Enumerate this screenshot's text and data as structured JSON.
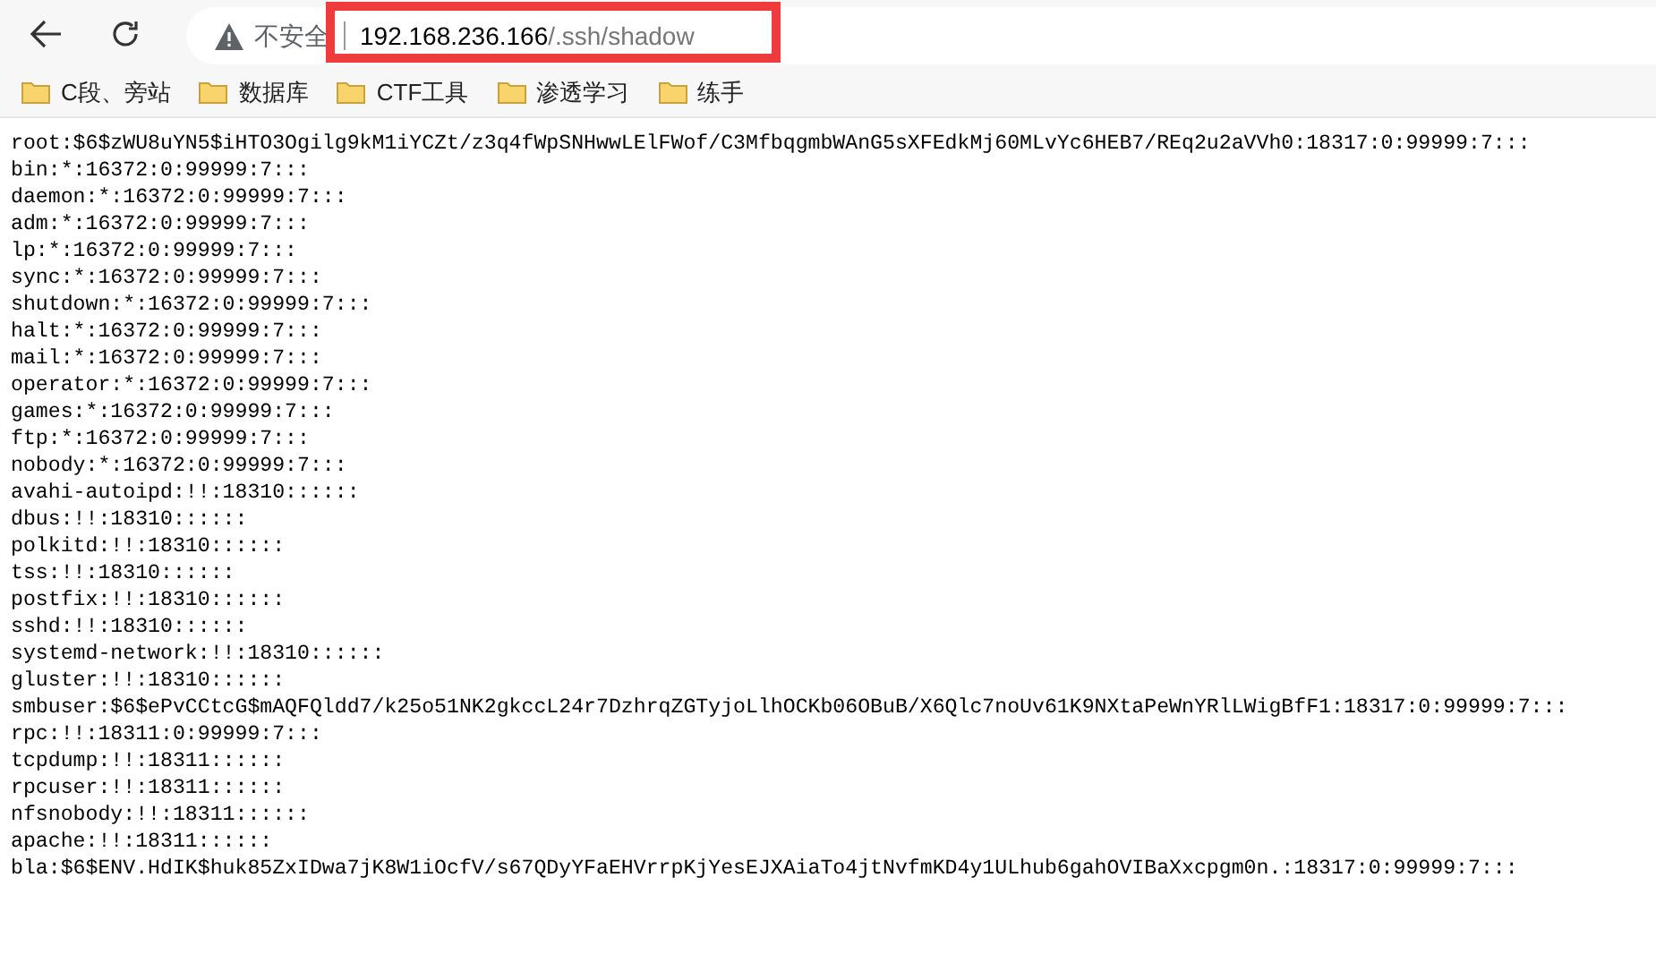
{
  "toolbar": {
    "security_label": "不安全",
    "url_host": "192.168.236.166",
    "url_path": "/.ssh/shadow"
  },
  "bookmarks": [
    "C段、旁站",
    "数据库",
    "CTF工具",
    "渗透学习",
    "练手"
  ],
  "content_lines": [
    "root:$6$zWU8uYN5$iHTO3Ogilg9kM1iYCZt/z3q4fWpSNHwwLElFWof/C3MfbqgmbWAnG5sXFEdkMj60MLvYc6HEB7/REq2u2aVVh0:18317:0:99999:7:::",
    "bin:*:16372:0:99999:7:::",
    "daemon:*:16372:0:99999:7:::",
    "adm:*:16372:0:99999:7:::",
    "lp:*:16372:0:99999:7:::",
    "sync:*:16372:0:99999:7:::",
    "shutdown:*:16372:0:99999:7:::",
    "halt:*:16372:0:99999:7:::",
    "mail:*:16372:0:99999:7:::",
    "operator:*:16372:0:99999:7:::",
    "games:*:16372:0:99999:7:::",
    "ftp:*:16372:0:99999:7:::",
    "nobody:*:16372:0:99999:7:::",
    "avahi-autoipd:!!:18310::::::",
    "dbus:!!:18310::::::",
    "polkitd:!!:18310::::::",
    "tss:!!:18310::::::",
    "postfix:!!:18310::::::",
    "sshd:!!:18310::::::",
    "systemd-network:!!:18310::::::",
    "gluster:!!:18310::::::",
    "smbuser:$6$ePvCCtcG$mAQFQldd7/k25o51NK2gkccL24r7DzhrqZGTyjoLlhOCKb06OBuB/X6Qlc7noUv61K9NXtaPeWnYRlLWigBfF1:18317:0:99999:7:::",
    "rpc:!!:18311:0:99999:7:::",
    "tcpdump:!!:18311::::::",
    "rpcuser:!!:18311::::::",
    "nfsnobody:!!:18311::::::",
    "apache:!!:18311::::::",
    "bla:$6$ENV.HdIK$huk85ZxIDwa7jK8W1iOcfV/s67QDyYFaEHVrrpKjYesEJXAiaTo4jtNvfmKD4y1ULhub6gahOVIBaXxcpgm0n.:18317:0:99999:7:::"
  ]
}
